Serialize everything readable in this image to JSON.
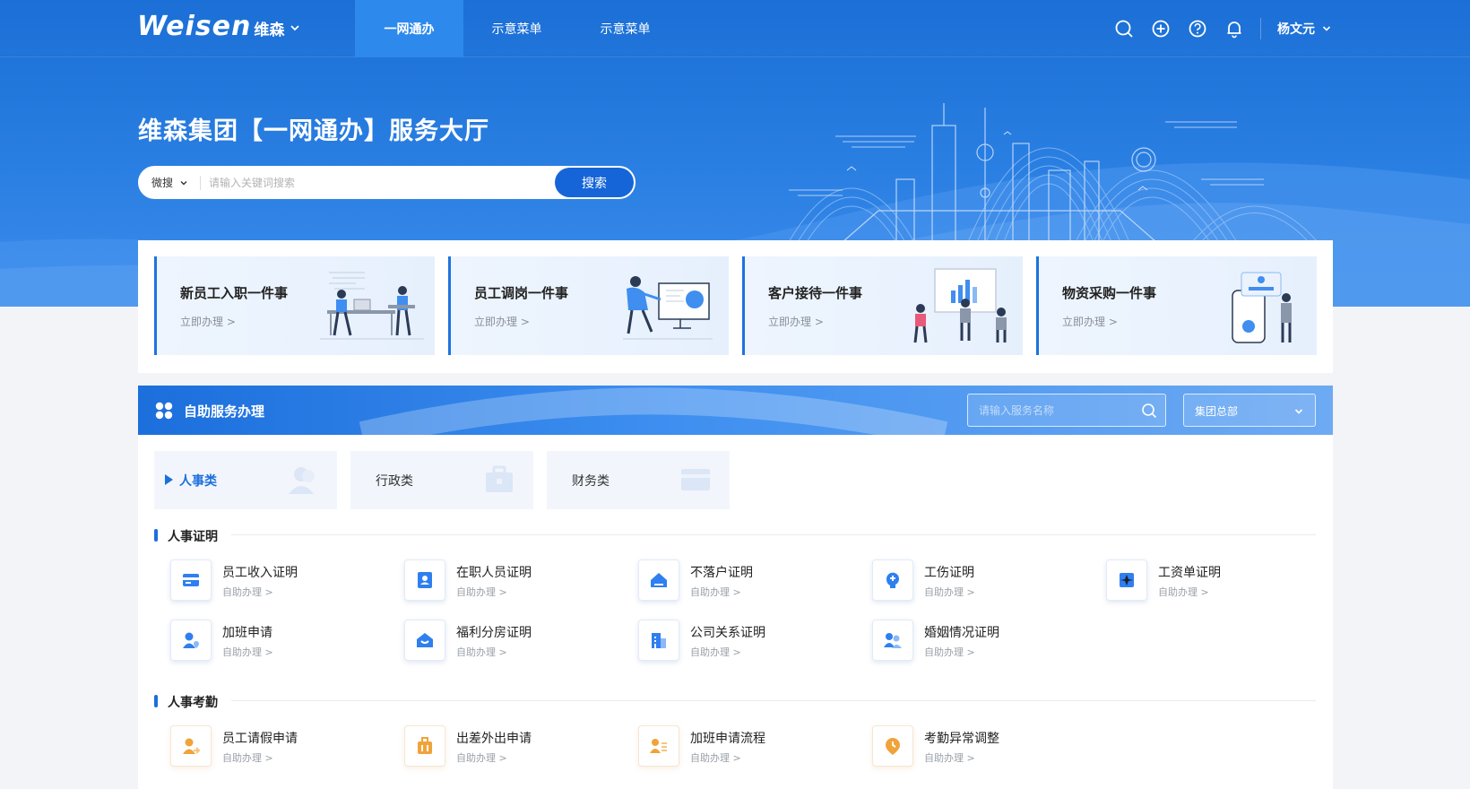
{
  "colors": {
    "primary": "#1c6fdc",
    "header": "#1b6fd6",
    "accent_orange": "#f0a33a"
  },
  "nav": {
    "logo_main": "Weisen",
    "logo_sub": "维森",
    "tabs": [
      "一网通办",
      "示意菜单",
      "示意菜单"
    ],
    "active_tab": 0,
    "icons": [
      "search-icon",
      "plus-circle-icon",
      "help-icon",
      "bell-icon"
    ],
    "user_name": "杨文元"
  },
  "hero": {
    "title": "维森集团【一网通办】服务大厅",
    "search_scope": "微搜",
    "search_placeholder": "请输入关键词搜索",
    "search_button": "搜索"
  },
  "quick_cards": [
    {
      "title": "新员工入职一件事",
      "link": "立即办理 >"
    },
    {
      "title": "员工调岗一件事",
      "link": "立即办理 >"
    },
    {
      "title": "客户接待一件事",
      "link": "立即办理 >"
    },
    {
      "title": "物资采购一件事",
      "link": "立即办理 >"
    }
  ],
  "self_service": {
    "title": "自助服务办理",
    "search_placeholder": "请输入服务名称",
    "org_select": "集团总部",
    "categories": [
      "人事类",
      "行政类",
      "财务类"
    ],
    "active_category": 0,
    "sections": [
      {
        "title": "人事证明",
        "items": [
          {
            "name": "员工收入证明",
            "link": "自助办理 >",
            "icon": "card-icon"
          },
          {
            "name": "在职人员证明",
            "link": "自助办理 >",
            "icon": "id-badge-icon"
          },
          {
            "name": "不落户证明",
            "link": "自助办理 >",
            "icon": "home-icon"
          },
          {
            "name": "工伤证明",
            "link": "自助办理 >",
            "icon": "head-plus-icon"
          },
          {
            "name": "工资单证明",
            "link": "自助办理 >",
            "icon": "sparkle-doc-icon"
          },
          {
            "name": "加班申请",
            "link": "自助办理 >",
            "icon": "user-location-icon"
          },
          {
            "name": "福利分房证明",
            "link": "自助办理 >",
            "icon": "house-smile-icon"
          },
          {
            "name": "公司关系证明",
            "link": "自助办理 >",
            "icon": "building-icon"
          },
          {
            "name": "婚姻情况证明",
            "link": "自助办理 >",
            "icon": "couple-icon"
          }
        ]
      },
      {
        "title": "人事考勤",
        "items": [
          {
            "name": "员工请假申请",
            "link": "自助办理 >",
            "icon": "user-arrow-icon"
          },
          {
            "name": "出差外出申请",
            "link": "自助办理 >",
            "icon": "suitcase-icon"
          },
          {
            "name": "加班申请流程",
            "link": "自助办理 >",
            "icon": "user-list-icon"
          },
          {
            "name": "考勤异常调整",
            "link": "自助办理 >",
            "icon": "clock-pin-icon"
          }
        ]
      }
    ]
  }
}
